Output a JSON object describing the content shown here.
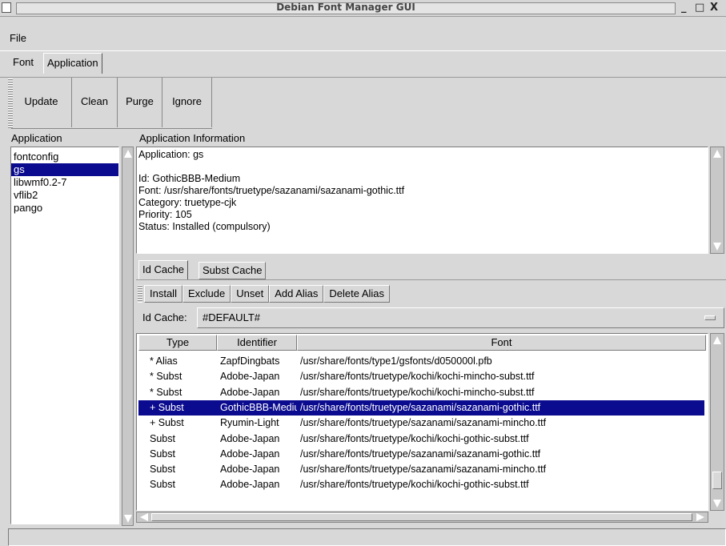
{
  "window": {
    "title": "Debian Font Manager GUI",
    "minimize_glyph": "_",
    "maximize_glyph": "□",
    "close_glyph": "X"
  },
  "menu": {
    "file": "File"
  },
  "tabs": [
    "Font",
    "Application"
  ],
  "toolbar": [
    "Update",
    "Clean",
    "Purge",
    "Ignore"
  ],
  "sidebar": {
    "header": "Application",
    "items": [
      "fontconfig",
      "gs",
      "libwmf0.2-7",
      "vflib2",
      "pango"
    ],
    "selected": 1
  },
  "info": {
    "header": "Application Information",
    "lines": [
      "Application: gs",
      "",
      "Id: GothicBBB-Medium",
      "Font: /usr/share/fonts/truetype/sazanami/sazanami-gothic.ttf",
      "Category: truetype-cjk",
      "Priority: 105",
      "Status: Installed (compulsory)"
    ]
  },
  "subtabs": [
    "Id Cache",
    "Subst Cache"
  ],
  "actions": [
    "Install",
    "Exclude",
    "Unset",
    "Add Alias",
    "Delete Alias"
  ],
  "cache_selector": {
    "label": "Id Cache:",
    "value": "#DEFAULT#"
  },
  "table": {
    "columns": [
      "Type",
      "Identifier",
      "Font"
    ],
    "rows": [
      [
        "* Alias",
        "ZapfDingbats",
        "/usr/share/fonts/type1/gsfonts/d050000l.pfb"
      ],
      [
        "* Subst",
        "Adobe-Japan",
        "/usr/share/fonts/truetype/kochi/kochi-mincho-subst.ttf"
      ],
      [
        "* Subst",
        "Adobe-Japan",
        "/usr/share/fonts/truetype/kochi/kochi-mincho-subst.ttf"
      ],
      [
        "+ Subst",
        "GothicBBB-Medium",
        "/usr/share/fonts/truetype/sazanami/sazanami-gothic.ttf"
      ],
      [
        "+ Subst",
        "Ryumin-Light",
        "/usr/share/fonts/truetype/sazanami/sazanami-mincho.ttf"
      ],
      [
        "Subst",
        "Adobe-Japan",
        "/usr/share/fonts/truetype/kochi/kochi-gothic-subst.ttf"
      ],
      [
        "Subst",
        "Adobe-Japan",
        "/usr/share/fonts/truetype/sazanami/sazanami-gothic.ttf"
      ],
      [
        "Subst",
        "Adobe-Japan",
        "/usr/share/fonts/truetype/sazanami/sazanami-mincho.ttf"
      ],
      [
        "Subst",
        "Adobe-Japan",
        "/usr/share/fonts/truetype/kochi/kochi-gothic-subst.ttf"
      ]
    ],
    "selected_row": 3
  },
  "colors": {
    "selection": "#0b0b8f",
    "background": "#d8d8d8"
  }
}
